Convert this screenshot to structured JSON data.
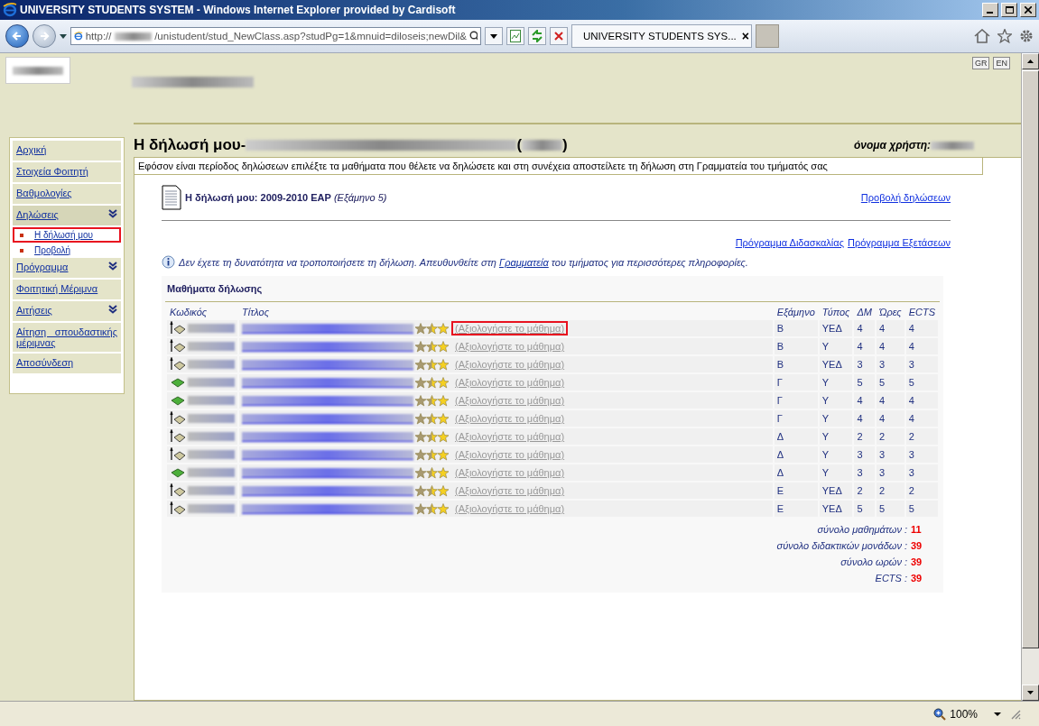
{
  "window": {
    "title": "UNIVERSITY STUDENTS SYSTEM - Windows Internet Explorer provided by Cardisoft"
  },
  "address_bar": {
    "scheme": "http://",
    "path": "/unistudent/stud_NewClass.asp?studPg=1&mnuid=diloseis;newDil&"
  },
  "tab": {
    "label": "UNIVERSITY STUDENTS SYS...",
    "close": "×"
  },
  "languages": [
    "GR",
    "EN"
  ],
  "sidebar": {
    "items": [
      {
        "label": "Αρχική",
        "expandable": false,
        "expanded": false
      },
      {
        "label": "Στοιχεία Φοιτητή",
        "expandable": false,
        "expanded": false
      },
      {
        "label": "Βαθμολογίες",
        "expandable": false,
        "expanded": false
      },
      {
        "label": "Δηλώσεις",
        "expandable": true,
        "expanded": true,
        "children": [
          {
            "label": "Η δήλωσή μου",
            "highlighted": true
          },
          {
            "label": "Προβολή",
            "highlighted": false
          }
        ]
      },
      {
        "label": "Πρόγραμμα",
        "expandable": true,
        "expanded": false
      },
      {
        "label": "Φοιτητική Μέριμνα",
        "expandable": false,
        "expanded": false
      },
      {
        "label": "Αιτήσεις",
        "expandable": true,
        "expanded": false
      },
      {
        "label": "Αίτηση σπουδαστικής μέριμνας",
        "expandable": false,
        "expanded": false
      },
      {
        "label": "Αποσύνδεση",
        "expandable": false,
        "expanded": false
      }
    ]
  },
  "page_title": {
    "prefix": "Η δήλωσή μου-",
    "open": "(",
    "close": ")"
  },
  "username_label": "όνομα χρήστη:",
  "notice": "Εφόσον είναι περίοδος δηλώσεων επιλέξτε τα μαθήματα που θέλετε να δηλώσετε και στη συνέχεια αποστείλετε τη δήλωση στη Γραμματεία του τμήματός σας",
  "declaration": {
    "heading": "**Η δήλωσή μου: 2009-2010 ΕΑΡ** *(Εξάμηνο 5)*",
    "view_link": "Προβολή δηλώσεων"
  },
  "schedule_links": [
    "Πρόγραμμα Διδασκαλίας",
    "Πρόγραμμα Εξετάσεων"
  ],
  "info": {
    "before": "Δεν έχετε τη δυνατότητα να τροποποιήσετε τη δήλωση. Απευθυνθείτε στη ",
    "link": "Γραμματεία",
    "after": " του τμήματος για περισσότερες πληροφορίες."
  },
  "courses": {
    "heading": "Μαθήματα δήλωσης",
    "columns": [
      "Κωδικός",
      "Τίτλος",
      "Εξάμηνο",
      "Τύπος",
      "ΔΜ",
      "Ώρες",
      "ECTS"
    ],
    "rows": [
      {
        "kind": "transfer",
        "rate_link": "(Αξιολογήστε το μάθημα)",
        "highlighted": true,
        "semester": "Β",
        "type": "ΥΕΔ",
        "dm": "4",
        "hours": "4",
        "ects": "4"
      },
      {
        "kind": "transfer",
        "rate_link": "(Αξιολογήστε το μάθημα)",
        "highlighted": false,
        "semester": "Β",
        "type": "Υ",
        "dm": "4",
        "hours": "4",
        "ects": "4"
      },
      {
        "kind": "transfer",
        "rate_link": "(Αξιολογήστε το μάθημα)",
        "highlighted": false,
        "semester": "Β",
        "type": "ΥΕΔ",
        "dm": "3",
        "hours": "3",
        "ects": "3"
      },
      {
        "kind": "book",
        "rate_link": "(Αξιολογήστε το μάθημα)",
        "highlighted": false,
        "semester": "Γ",
        "type": "Υ",
        "dm": "5",
        "hours": "5",
        "ects": "5"
      },
      {
        "kind": "book",
        "rate_link": "(Αξιολογήστε το μάθημα)",
        "highlighted": false,
        "semester": "Γ",
        "type": "Υ",
        "dm": "4",
        "hours": "4",
        "ects": "4"
      },
      {
        "kind": "transfer",
        "rate_link": "(Αξιολογήστε το μάθημα)",
        "highlighted": false,
        "semester": "Γ",
        "type": "Υ",
        "dm": "4",
        "hours": "4",
        "ects": "4"
      },
      {
        "kind": "transfer",
        "rate_link": "(Αξιολογήστε το μάθημα)",
        "highlighted": false,
        "semester": "Δ",
        "type": "Υ",
        "dm": "2",
        "hours": "2",
        "ects": "2"
      },
      {
        "kind": "transfer",
        "rate_link": "(Αξιολογήστε το μάθημα)",
        "highlighted": false,
        "semester": "Δ",
        "type": "Υ",
        "dm": "3",
        "hours": "3",
        "ects": "3"
      },
      {
        "kind": "book",
        "rate_link": "(Αξιολογήστε το μάθημα)",
        "highlighted": false,
        "semester": "Δ",
        "type": "Υ",
        "dm": "3",
        "hours": "3",
        "ects": "3"
      },
      {
        "kind": "transfer",
        "rate_link": "(Αξιολογήστε το μάθημα)",
        "highlighted": false,
        "semester": "Ε",
        "type": "ΥΕΔ",
        "dm": "2",
        "hours": "2",
        "ects": "2"
      },
      {
        "kind": "transfer",
        "rate_link": "(Αξιολογήστε το μάθημα)",
        "highlighted": false,
        "semester": "Ε",
        "type": "ΥΕΔ",
        "dm": "5",
        "hours": "5",
        "ects": "5"
      }
    ],
    "totals": [
      {
        "label": "σύνολο μαθημάτων :",
        "value": "11"
      },
      {
        "label": "σύνολο διδακτικών μονάδων :",
        "value": "39"
      },
      {
        "label": "σύνολο ωρών :",
        "value": "39"
      },
      {
        "label": "ECTS :",
        "value": "39"
      }
    ]
  },
  "status_bar": {
    "zoom": "100%"
  }
}
